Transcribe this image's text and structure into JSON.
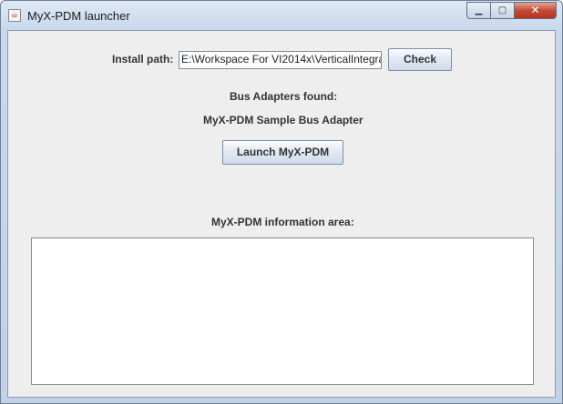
{
  "window": {
    "title": "MyX-PDM launcher",
    "min_glyph": "▁",
    "max_glyph": "▢",
    "close_glyph": "✕"
  },
  "form": {
    "install_path_label": "Install path:",
    "install_path_value": "E:\\Workspace For VI2014x\\VerticalIntegra",
    "check_button": "Check",
    "bus_adapters_label": "Bus Adapters found:",
    "bus_adapter_name": "MyX-PDM Sample Bus Adapter",
    "launch_button": "Launch MyX-PDM",
    "info_area_label": "MyX-PDM information area:",
    "info_area_text": ""
  },
  "colors": {
    "client_background": "#eeeeee",
    "titlebar_gradient_top": "#dfe9f5",
    "close_button": "#c64a36"
  },
  "icons": {
    "app_icon": "java-coffee-cup-icon"
  }
}
